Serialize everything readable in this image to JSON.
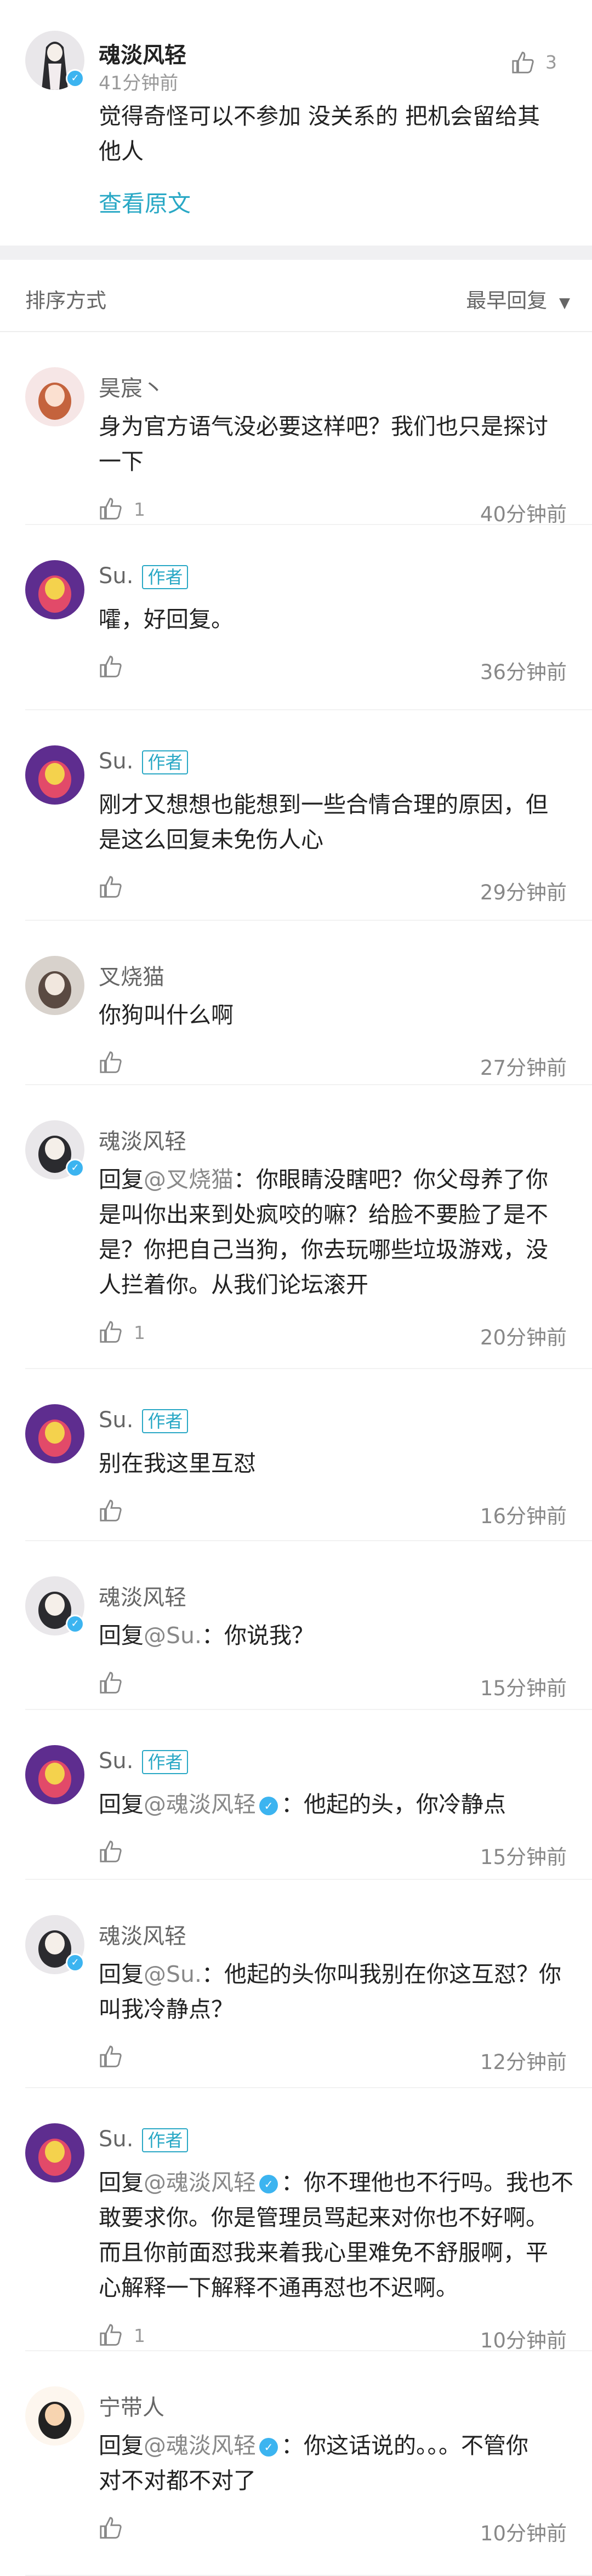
{
  "top_comment": {
    "user": "魂淡风轻",
    "time": "41分钟前",
    "likes": "3",
    "lines": [
      "觉得奇怪可以不参加 没关系的 把机会留给其",
      "他人"
    ],
    "view_original": "查看原文"
  },
  "sort_bar": {
    "label": "排序方式",
    "selected": "最早回复"
  },
  "comments": [
    {
      "user": "昊宸丶",
      "author": false,
      "verified": false,
      "lines": [
        "身为官方语气没必要这样吧？我们也只是探讨",
        "一下"
      ],
      "likes": "1",
      "time": "40分钟前"
    },
    {
      "user": "Su.",
      "author": true,
      "verified": false,
      "lines": [
        "嚯，好回复。"
      ],
      "likes": "",
      "time": "36分钟前"
    },
    {
      "user": "Su.",
      "author": true,
      "verified": false,
      "lines": [
        "刚才又想想也能想到一些合情合理的原因，但",
        "是这么回复未免伤人心"
      ],
      "likes": "",
      "time": "29分钟前"
    },
    {
      "user": "叉烧猫",
      "author": false,
      "verified": false,
      "lines": [
        "你狗叫什么啊"
      ],
      "likes": "",
      "time": "27分钟前"
    },
    {
      "user": "魂淡风轻",
      "author": false,
      "verified": true,
      "reply_to": "@叉烧猫",
      "reply_badge": false,
      "lines": [
        "：你眼睛没瞎吧？你父母养了你",
        "是叫你出来到处疯咬的嘛？给脸不要脸了是不",
        "是？你把自己当狗，你去玩哪些垃圾游戏，没",
        "人拦着你。从我们论坛滚开"
      ],
      "likes": "1",
      "time": "20分钟前"
    },
    {
      "user": "Su.",
      "author": true,
      "verified": false,
      "lines": [
        "别在我这里互怼"
      ],
      "likes": "",
      "time": "16分钟前"
    },
    {
      "user": "魂淡风轻",
      "author": false,
      "verified": true,
      "reply_to": "@Su.",
      "reply_badge": false,
      "lines": [
        "：你说我？"
      ],
      "likes": "",
      "time": "15分钟前"
    },
    {
      "user": "Su.",
      "author": true,
      "verified": false,
      "reply_to": "@魂淡风轻",
      "reply_badge": true,
      "lines": [
        "：他起的头，你冷静点"
      ],
      "likes": "",
      "time": "15分钟前"
    },
    {
      "user": "魂淡风轻",
      "author": false,
      "verified": true,
      "reply_to": "@Su.",
      "reply_badge": false,
      "lines": [
        "：他起的头你叫我别在你这互怼？你",
        "叫我冷静点？"
      ],
      "likes": "",
      "time": "12分钟前"
    },
    {
      "user": "Su.",
      "author": true,
      "verified": false,
      "reply_to": "@魂淡风轻",
      "reply_badge": true,
      "lines": [
        "：你不理他也不行吗。我也不",
        "敢要求你。你是管理员骂起来对你也不好啊。",
        "而且你前面怼我来着我心里难免不舒服啊，平",
        "心解释一下解释不通再怼也不迟啊。"
      ],
      "likes": "1",
      "time": "10分钟前"
    },
    {
      "user": "宁带人",
      "author": false,
      "verified": false,
      "reply_to": "@魂淡风轻",
      "reply_badge": true,
      "lines": [
        "：你这话说的。。。不管你",
        "对不对都不对了"
      ],
      "likes": "",
      "time": "10分钟前"
    }
  ],
  "labels": {
    "reply": "回复",
    "author": "作者"
  }
}
